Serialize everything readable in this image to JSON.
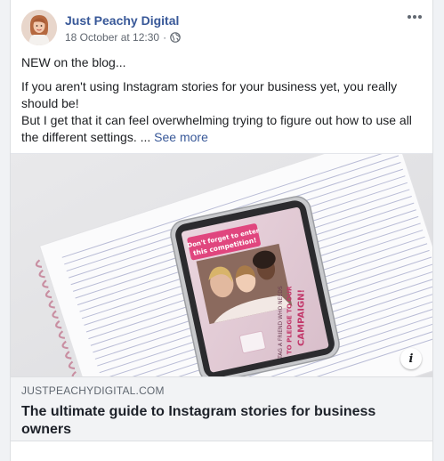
{
  "post": {
    "page_name": "Just Peachy Digital",
    "timestamp": "18 October at 12:30",
    "separator": "·",
    "privacy_icon": "globe-icon",
    "more_icon": "more-horizontal-icon",
    "text": {
      "line1": "NEW on the blog...",
      "line2": "If you aren't using Instagram stories for your business yet, you really should be!",
      "line3": "But I get that it can feel overwhelming trying to figure out how to use all the different settings. ...",
      "see_more": "See more"
    }
  },
  "link_preview": {
    "domain": "JUSTPEACHYDIGITAL.COM",
    "title": "The ultimate guide to Instagram stories for business owners",
    "info_icon": "info-icon",
    "info_label": "i",
    "image_text": {
      "banner": "Don't forget to enter this competition!",
      "cta_line1": "TAG A FRIEND WHO NEEDS",
      "cta_line2": "TO PLEDGE TO OUR",
      "cta_line3": "CAMPAIGN!"
    }
  },
  "colors": {
    "link_blue": "#385898",
    "meta_grey": "#606770",
    "preview_bg": "#f2f3f5"
  }
}
